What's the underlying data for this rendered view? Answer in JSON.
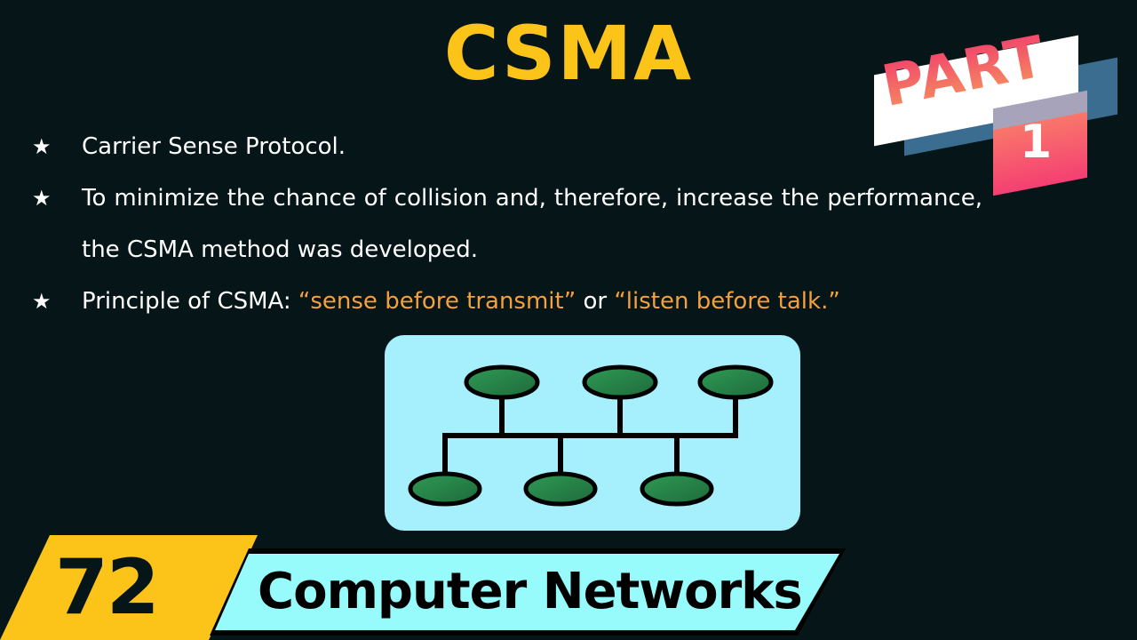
{
  "slide": {
    "title": "CSMA",
    "part_label": "PART",
    "part_number": "1",
    "bullets": [
      {
        "text": "Carrier Sense Protocol."
      },
      {
        "text": "To minimize the chance of collision and, therefore, increase the performance, the CSMA method was developed."
      },
      {
        "prefix": "Principle of CSMA: ",
        "quote1": "“sense before transmit”",
        "middle": " or ",
        "quote2": "“listen before talk.”"
      }
    ],
    "bullet_icon": "star-icon",
    "diagram": {
      "type": "bus-topology",
      "top_nodes": 3,
      "bottom_nodes": 3
    }
  },
  "footer": {
    "episode_number": "72",
    "series_title": "Computer Networks"
  },
  "colors": {
    "background": "#051518",
    "title": "#fcc419",
    "highlight": "#f3a13c",
    "diagram_bg": "#a6f0fd",
    "node_fill": "#2a8a4e",
    "banner_bg": "#97fbfb",
    "part_pink": "#f43f72",
    "part_blue": "#3b6d91"
  }
}
